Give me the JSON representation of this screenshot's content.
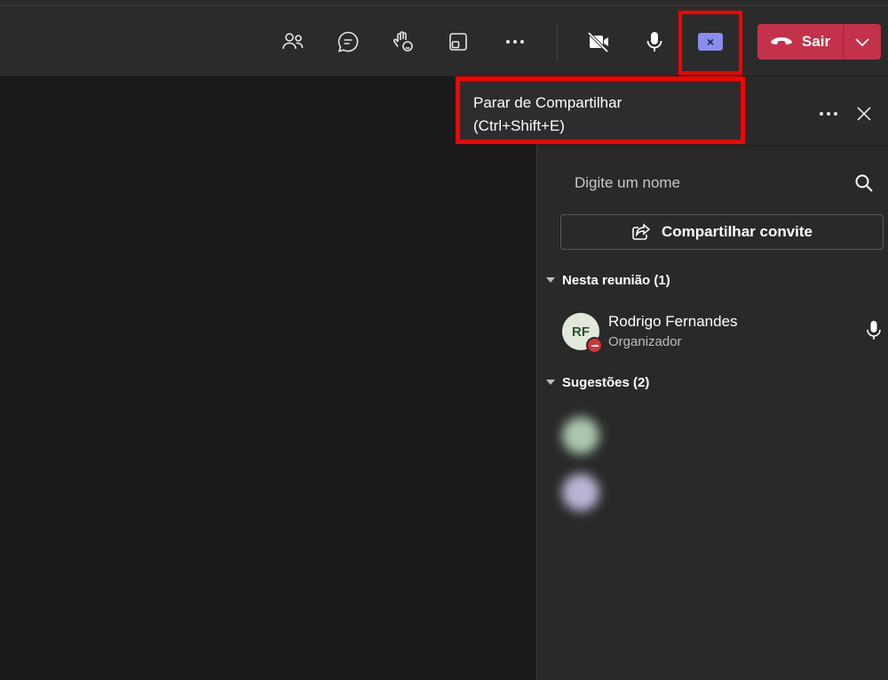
{
  "toolbar": {
    "leave_label": "Sair",
    "share_stop_glyph": "×",
    "icons": [
      "people-icon",
      "chat-icon",
      "raise-hand-icon",
      "view-icon",
      "more-icon",
      "camera-off-icon",
      "microphone-icon",
      "stop-sharing-icon",
      "phone-icon",
      "chevron-down-icon"
    ]
  },
  "tooltip": {
    "line1": "Parar de Compartilhar",
    "line2": "(Ctrl+Shift+E)"
  },
  "panel": {
    "search_placeholder": "Digite um nome",
    "invite_label": "Compartilhar convite",
    "in_meeting_header": "Nesta reunião (1)",
    "suggestions_header": "Sugestões (2)",
    "participants": [
      {
        "initials": "RF",
        "name": "Rodrigo Fernandes",
        "role": "Organizador",
        "status": "do-not-disturb"
      }
    ],
    "suggestions": [
      {
        "name": "",
        "color": "#b9d8bd"
      },
      {
        "name": "",
        "color": "#c9c4e8"
      }
    ]
  },
  "colors": {
    "leave_red": "#c4314b",
    "share_accent": "#8b8cf0",
    "highlight_red": "#ff0000",
    "panel_bg": "#292929",
    "stage_bg": "#1b1b1b"
  }
}
